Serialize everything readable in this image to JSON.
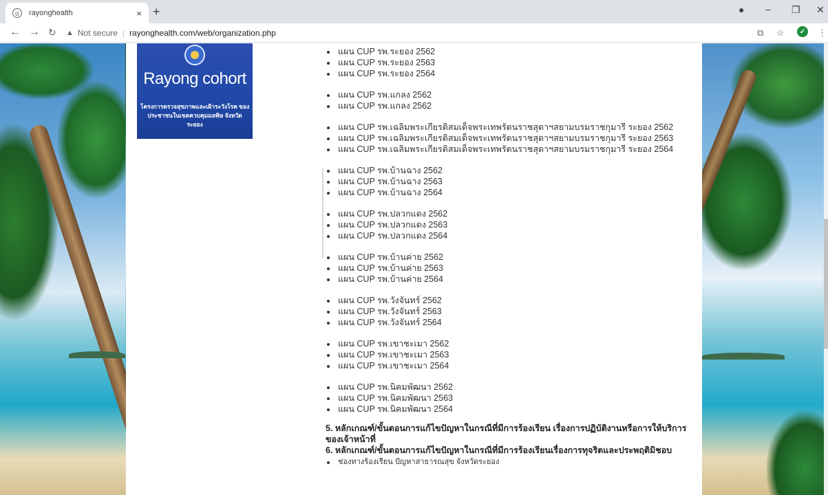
{
  "browser": {
    "tab_title": "rayonghealth",
    "tab_close": "×",
    "new_tab": "+",
    "not_secure": "Not secure",
    "url": "rayonghealth.com/web/organization.php",
    "separator": "|"
  },
  "banner": {
    "title": "Rayong cohort",
    "subtitle": "โครงการตรวจสุขภาพและเฝ้าระวังโรค ของประชาชนในเขตควบคุมมลพิษ จังหวัดระยอง"
  },
  "groups": [
    {
      "items": [
        "แผน CUP รพ.ระยอง 2562",
        "แผน CUP รพ.ระยอง 2563",
        "แผน CUP รพ.ระยอง 2564"
      ]
    },
    {
      "items": [
        "แผน CUP รพ.แกลง 2562",
        "แผน CUP รพ.แกลง 2562"
      ]
    },
    {
      "items": [
        "แผน CUP รพ.เฉลิมพระเกียรติสมเด็จพระเทพรัตนราชสุดาฯสยามบรมราชกุมารี ระยอง 2562",
        "แผน CUP รพ.เฉลิมพระเกียรติสมเด็จพระเทพรัตนราชสุดาฯสยามบรมราชกุมารี ระยอง 2563",
        "แผน CUP รพ.เฉลิมพระเกียรติสมเด็จพระเทพรัตนราชสุดาฯสยามบรมราชกุมารี ระยอง 2564"
      ]
    },
    {
      "items": [
        "แผน CUP รพ.บ้านฉาง 2562",
        "แผน CUP รพ.บ้านฉาง 2563",
        "แผน CUP รพ.บ้านฉาง 2564"
      ]
    },
    {
      "items": [
        "แผน CUP รพ.ปลวกแดง 2562",
        "แผน CUP รพ.ปลวกแดง 2563",
        "แผน CUP รพ.ปลวกแดง 2564"
      ]
    },
    {
      "items": [
        "แผน CUP รพ.บ้านค่าย 2562",
        "แผน CUP รพ.บ้านค่าย 2563",
        "แผน CUP รพ.บ้านค่าย 2564"
      ]
    },
    {
      "items": [
        "แผน CUP รพ.วังจันทร์ 2562",
        "แผน CUP รพ.วังจันทร์ 2563",
        "แผน CUP รพ.วังจันทร์ 2564"
      ]
    },
    {
      "items": [
        "แผน CUP รพ.เขาชะเมา 2562",
        "แผน CUP รพ.เขาชะเมา 2563",
        "แผน CUP รพ.เขาชะเมา 2564"
      ]
    },
    {
      "items": [
        "แผน CUP รพ.นิคมพัฒนา 2562",
        "แผน CUP รพ.นิคมพัฒนา 2563",
        "แผน CUP รพ.นิคมพัฒนา 2564"
      ]
    }
  ],
  "sections": {
    "s5": "5. หลักเกณฑ์/ขั้นตอนการแก้ไขปัญหาในกรณีที่มีการร้องเรียน เรื่องการปฏิบัติงานหรือการให้บริการของเจ้าหน้าที่",
    "s6": "6. หลักเกณฑ์/ขั้นตอนการแก้ไขปัญหาในกรณีที่มีการร้องเรียนเรื่องการทุจริตและประพฤติมิชอบ",
    "s6_item": "ช่องทางร้องเรียน ปัญหาสาธารณสุข จังหวัดระยอง"
  }
}
